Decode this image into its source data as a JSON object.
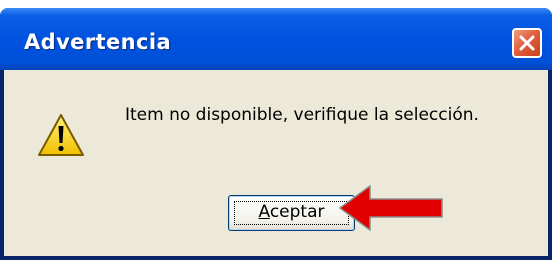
{
  "window": {
    "title": "Advertencia",
    "message": "Item no disponible, verifique la selección.",
    "ok_label_first": "A",
    "ok_label_rest": "ceptar"
  },
  "icons": {
    "warning": "warning-icon",
    "close": "close-icon",
    "annotation": "red-arrow-icon"
  },
  "colors": {
    "titlebar": "#0052e0",
    "body": "#ece9d8",
    "close": "#e06040",
    "arrow": "#e00000"
  }
}
